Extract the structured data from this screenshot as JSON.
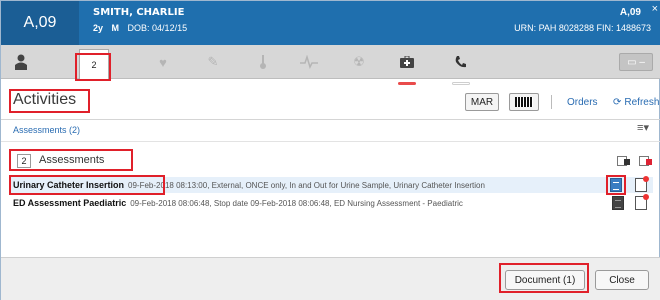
{
  "header": {
    "location": "A,09",
    "patient_name": "SMITH, CHARLIE",
    "age": "2y",
    "sex": "M",
    "dob": "DOB: 04/12/15",
    "location_right": "A,09",
    "ids": "URN: PAH 8028288  FIN: 1488673",
    "close": "×"
  },
  "iconbar": {
    "tab_count": "2",
    "icons": [
      "person-icon",
      "heart-icon",
      "pen-icon",
      "thermometer-icon",
      "vitals-icon",
      "radiation-icon",
      "medkit-icon",
      "phone-icon"
    ]
  },
  "page": {
    "title": "Activities",
    "mar_label": "MAR",
    "orders_label": "Orders",
    "refresh_label": "Refresh",
    "assessments_link": "Assessments (2)",
    "menu": "≡▾"
  },
  "section": {
    "count": "2",
    "title": "Assessments"
  },
  "rows": [
    {
      "name": "Urinary Catheter Insertion",
      "detail": "09-Feb-2018 08:13:00, External, ONCE only, In and Out for Urine Sample, Urinary Catheter Insertion"
    },
    {
      "name": "ED Assessment Paediatric",
      "detail": "09-Feb-2018 08:06:48, Stop date 09-Feb-2018 08:06:48, ED Nursing Assessment - Paediatric"
    }
  ],
  "footer": {
    "document_label": "Document (1)",
    "close_label": "Close"
  },
  "colors": {
    "header_bg": "#1f6fae",
    "highlight_red": "#e0202a",
    "link_blue": "#2a6cb2",
    "selected_row": "#e6f0fa"
  }
}
